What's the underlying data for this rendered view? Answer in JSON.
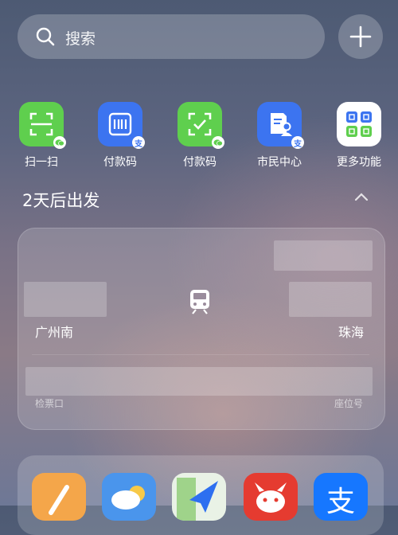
{
  "search": {
    "label": "搜索"
  },
  "quick_apps": [
    {
      "label": "扫一扫",
      "icon": "scan-icon",
      "color": "#5fcf4e"
    },
    {
      "label": "付款码",
      "icon": "barcode-icon",
      "color": "#3c74f0"
    },
    {
      "label": "付款码",
      "icon": "qr-check-icon",
      "color": "#5fcf4e"
    },
    {
      "label": "市民中心",
      "icon": "citizen-doc-icon",
      "color": "#3c74f0"
    },
    {
      "label": "更多功能",
      "icon": "grid-icon",
      "color": "#ffffff"
    }
  ],
  "trip": {
    "section_title": "2天后出发",
    "from": "广州南",
    "to": "珠海",
    "gate_label": "检票口",
    "seat_label": "座位号"
  },
  "dock_apps": [
    {
      "icon": "note-pencil-icon",
      "color": "#f4a64a"
    },
    {
      "icon": "weather-icon",
      "color": "#4a95ec"
    },
    {
      "icon": "maps-icon",
      "color": "#e9f2e6"
    },
    {
      "icon": "jd-icon",
      "color": "#e53b30"
    },
    {
      "icon": "alipay-icon",
      "color": "#1677ff"
    }
  ]
}
